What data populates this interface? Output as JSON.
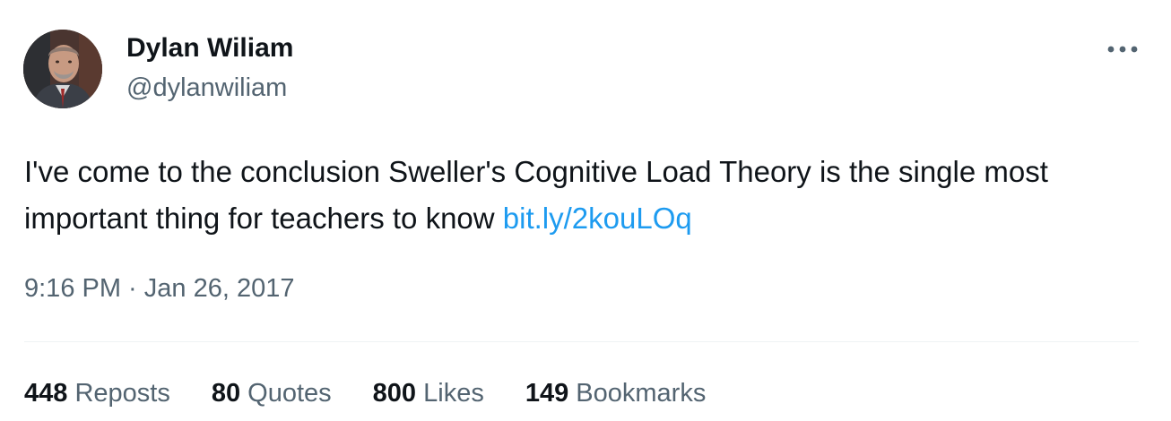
{
  "author": {
    "name": "Dylan Wiliam",
    "handle": "@dylanwiliam",
    "avatar_icon": "profile-photo"
  },
  "more_icon": "more-horizontal-icon",
  "tweet": {
    "text": "I've come to the conclusion Sweller's Cognitive Load Theory is the single most important thing for teachers to know ",
    "link_text": "bit.ly/2kouLOq"
  },
  "timestamp": {
    "time": "9:16 PM",
    "separator": " · ",
    "date": "Jan 26, 2017"
  },
  "stats": [
    {
      "count": "448",
      "label": "Reposts"
    },
    {
      "count": "80",
      "label": "Quotes"
    },
    {
      "count": "800",
      "label": "Likes"
    },
    {
      "count": "149",
      "label": "Bookmarks"
    }
  ],
  "colors": {
    "text_primary": "#0f1419",
    "text_secondary": "#536471",
    "link": "#1d9bf0",
    "divider": "#eff3f4"
  }
}
